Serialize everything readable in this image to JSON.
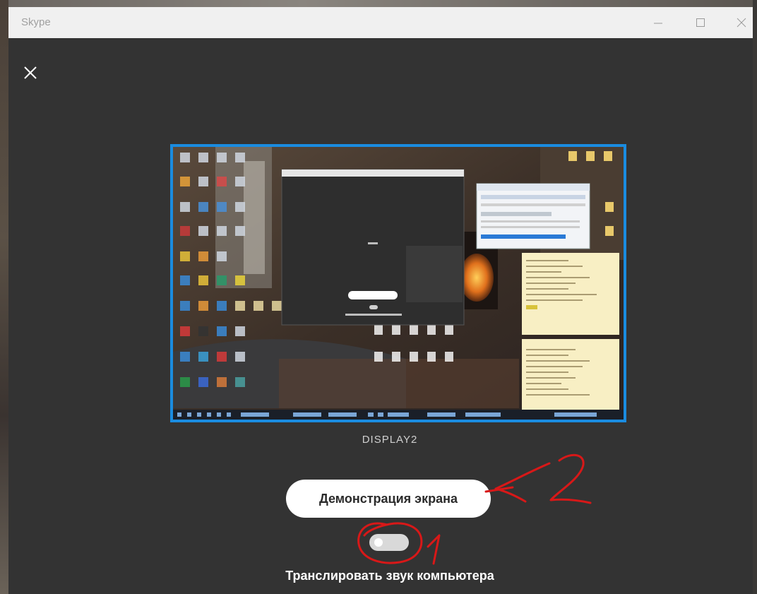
{
  "window": {
    "title": "Skype"
  },
  "titlebar": {
    "minimize_icon": "minimize-icon",
    "maximize_icon": "maximize-icon",
    "close_icon": "close-icon"
  },
  "panel": {
    "close_icon": "close-icon",
    "display_label": "DISPLAY2",
    "share_button_label": "Демонстрация экрана",
    "sound_toggle_on": false,
    "sound_label": "Транслировать звук компьютера"
  },
  "annotations": {
    "color": "#d81818",
    "mark_1": "1",
    "mark_2": "2"
  },
  "colors": {
    "accent": "#1a8ce0",
    "panel_bg": "#333333",
    "titlebar_bg": "#f0f0f0"
  }
}
